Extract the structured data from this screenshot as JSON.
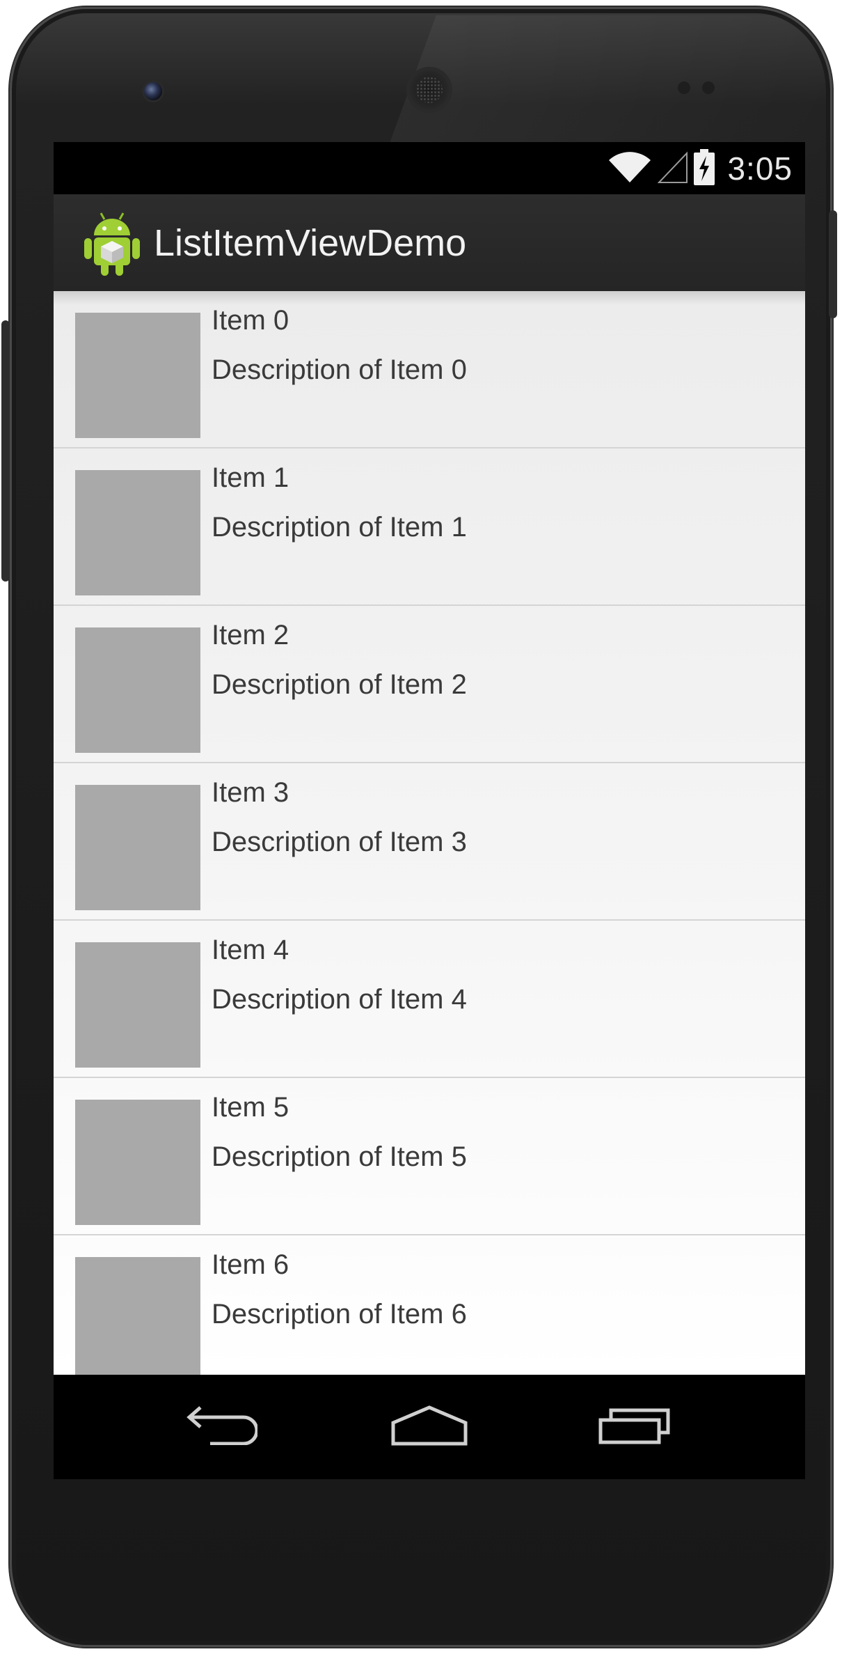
{
  "status_bar": {
    "time": "3:05",
    "icons": [
      "wifi-icon",
      "cell-signal-icon",
      "battery-charging-icon"
    ]
  },
  "action_bar": {
    "app_icon": "android-app-icon",
    "title": "ListItemViewDemo"
  },
  "list": {
    "items": [
      {
        "title": "Item 0",
        "description": "Description of Item 0"
      },
      {
        "title": "Item 1",
        "description": "Description of Item 1"
      },
      {
        "title": "Item 2",
        "description": "Description of Item 2"
      },
      {
        "title": "Item 3",
        "description": "Description of Item 3"
      },
      {
        "title": "Item 4",
        "description": "Description of Item 4"
      },
      {
        "title": "Item 5",
        "description": "Description of Item 5"
      },
      {
        "title": "Item 6",
        "description": "Description of Item 6"
      }
    ]
  },
  "nav_bar": {
    "buttons": [
      "back-icon",
      "home-icon",
      "recent-apps-icon"
    ]
  },
  "colors": {
    "thumbnail": "#a9a9a9",
    "action_bar": "#2a2a2a",
    "list_text": "#3a3a3a",
    "divider": "#d4d4d4"
  }
}
